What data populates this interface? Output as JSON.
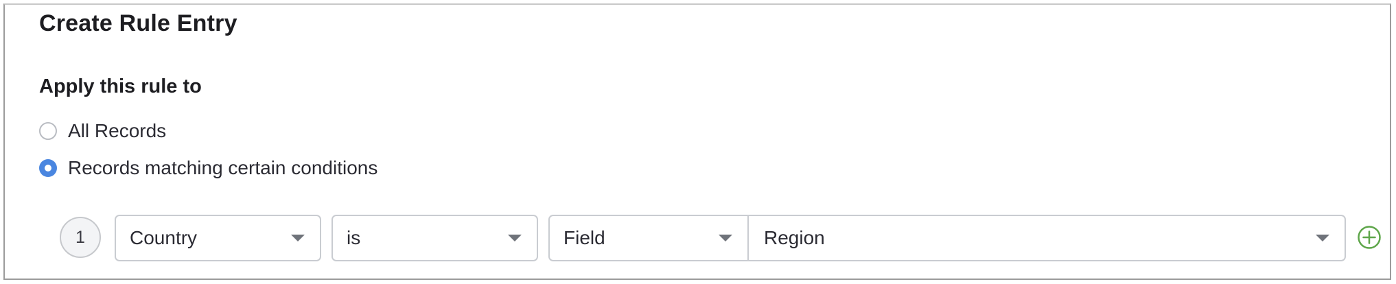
{
  "form": {
    "title": "Create Rule Entry",
    "section_heading": "Apply this rule to",
    "options": [
      {
        "label": "All Records",
        "selected": false
      },
      {
        "label": "Records matching certain conditions",
        "selected": true
      }
    ]
  },
  "condition": {
    "index": "1",
    "field": "Country",
    "operator": "is",
    "value_type": "Field",
    "value": "Region"
  },
  "icons": {
    "dropdown": "chevron-down-icon",
    "add": "plus-circle-icon"
  },
  "colors": {
    "radio_selected": "#4a86e0",
    "add_icon": "#5ea64a"
  }
}
